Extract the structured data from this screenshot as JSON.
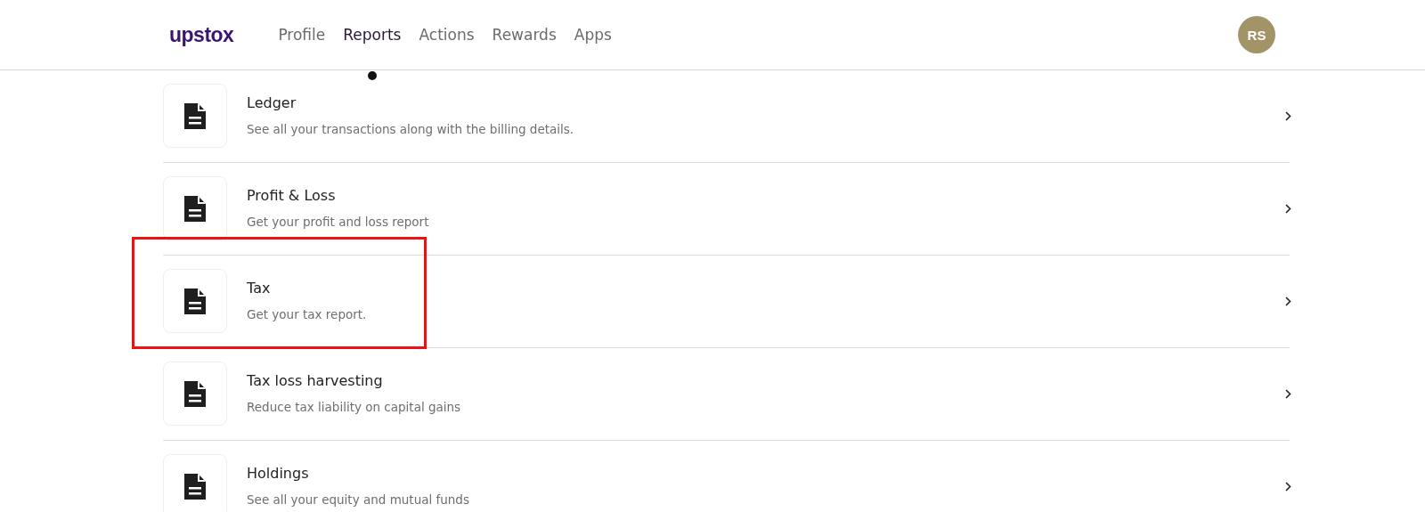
{
  "header": {
    "logo": "upstox",
    "nav": [
      {
        "label": "Profile",
        "selected": false
      },
      {
        "label": "Reports",
        "selected": true
      },
      {
        "label": "Actions",
        "selected": false
      },
      {
        "label": "Rewards",
        "selected": false
      },
      {
        "label": "Apps",
        "selected": false
      }
    ],
    "avatar": "RS"
  },
  "reports": [
    {
      "title": "Ledger",
      "description": "See all your transactions along with the billing details.",
      "highlighted": false
    },
    {
      "title": "Profit & Loss",
      "description": "Get your profit and loss report",
      "highlighted": false
    },
    {
      "title": "Tax",
      "description": "Get your tax report.",
      "highlighted": true
    },
    {
      "title": "Tax loss harvesting",
      "description": "Reduce tax liability on capital gains",
      "highlighted": false
    },
    {
      "title": "Holdings",
      "description": "See all your equity and mutual funds",
      "highlighted": false
    }
  ]
}
